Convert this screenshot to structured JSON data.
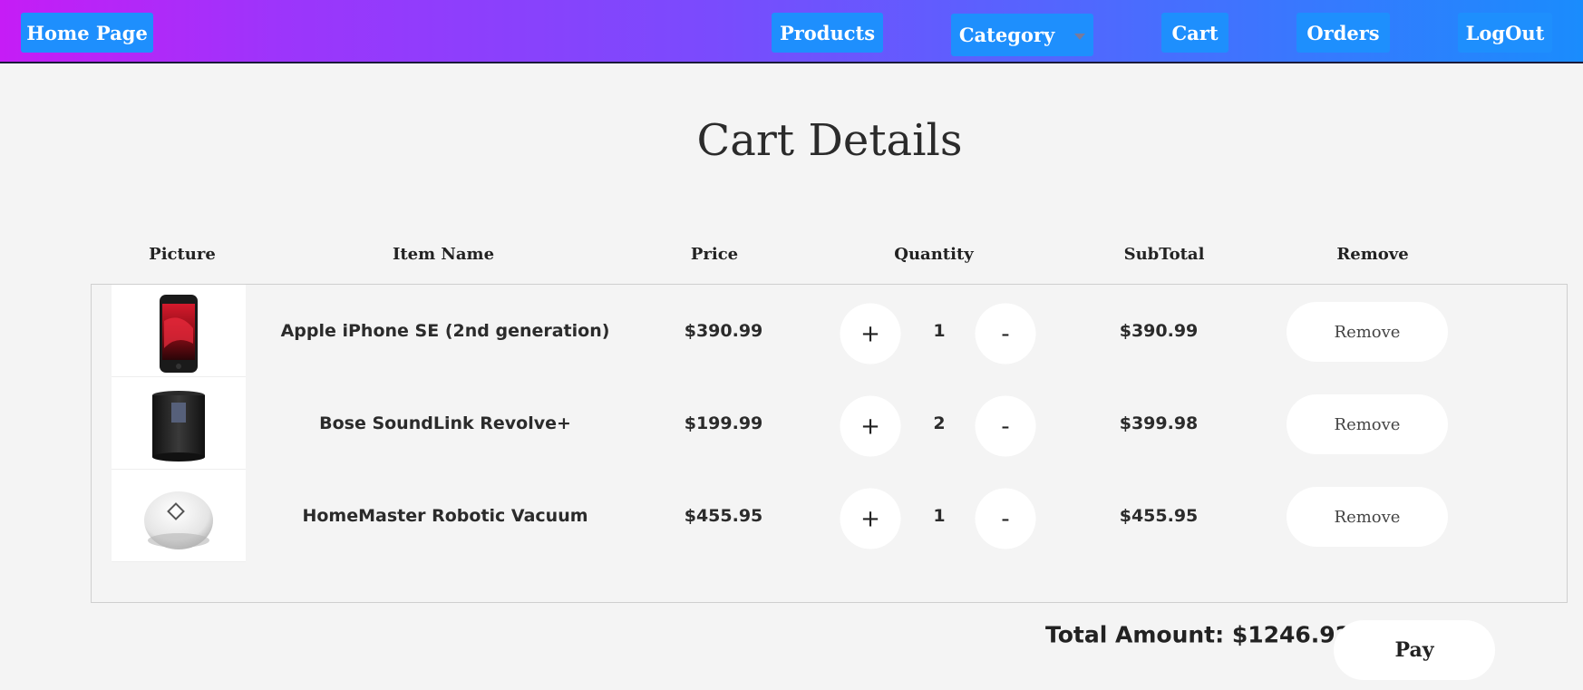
{
  "nav": {
    "home": "Home Page",
    "products": "Products",
    "category": "Category",
    "cart": "Cart",
    "orders": "Orders",
    "logout": "LogOut"
  },
  "page": {
    "title": "Cart Details"
  },
  "table": {
    "headers": [
      "Picture",
      "Item Name",
      "Price",
      "Quantity",
      "SubTotal",
      "Remove"
    ],
    "rows": [
      {
        "name": "Apple iPhone SE (2nd generation)",
        "price": "$390.99",
        "quantity": "1",
        "subtotal": "$390.99",
        "remove_label": "Remove",
        "image": "iphone-image"
      },
      {
        "name": "Bose SoundLink Revolve+",
        "price": "$199.99",
        "quantity": "2",
        "subtotal": "$399.98",
        "remove_label": "Remove",
        "image": "speaker-image"
      },
      {
        "name": "HomeMaster Robotic Vacuum",
        "price": "$455.95",
        "quantity": "1",
        "subtotal": "$455.95",
        "remove_label": "Remove",
        "image": "vacuum-image"
      }
    ],
    "increment_label": "+",
    "decrement_label": "-"
  },
  "footer": {
    "total_text": "Total Amount: $1246.92",
    "pay_label": "Pay"
  },
  "colors": {
    "nav_button": "#1e8ffd",
    "nav_gradient_start": "#c61cf6",
    "nav_gradient_end": "#1a8cfd",
    "background": "#f4f4f4"
  }
}
